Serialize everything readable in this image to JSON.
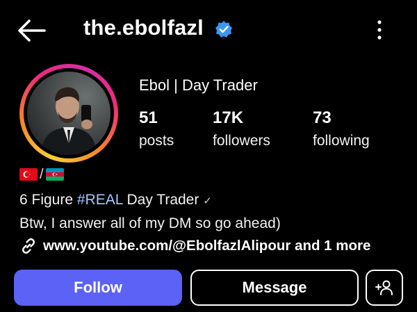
{
  "header": {
    "username": "the.ebolfazl",
    "back_icon": "arrow-left-icon",
    "verified_icon": "verified-badge-icon",
    "menu_icon": "more-vertical-icon"
  },
  "profile": {
    "display_name": "Ebol | Day Trader",
    "stats": [
      {
        "value": "51",
        "label": "posts"
      },
      {
        "value": "17K",
        "label": "followers"
      },
      {
        "value": "73",
        "label": "following"
      }
    ],
    "flags_separator": "/",
    "flags": [
      "turkey-flag",
      "azerbaijan-flag"
    ]
  },
  "bio": {
    "line1_prefix": "6 Figure ",
    "line1_hashtag": "#REAL",
    "line1_suffix": " Day Trader",
    "line1_mark": "✓",
    "line2": "Btw, I answer all of my DM so go ahead)"
  },
  "link": {
    "text": "www.youtube.com/@EbolfazlAlipour and 1 more",
    "icon": "link-icon"
  },
  "actions": {
    "follow_label": "Follow",
    "message_label": "Message",
    "add_icon": "add-person-icon"
  },
  "colors": {
    "background": "#000000",
    "follow_button": "#5b62f5",
    "hashtag": "#a5c8ff",
    "verified": "#3897f0"
  }
}
